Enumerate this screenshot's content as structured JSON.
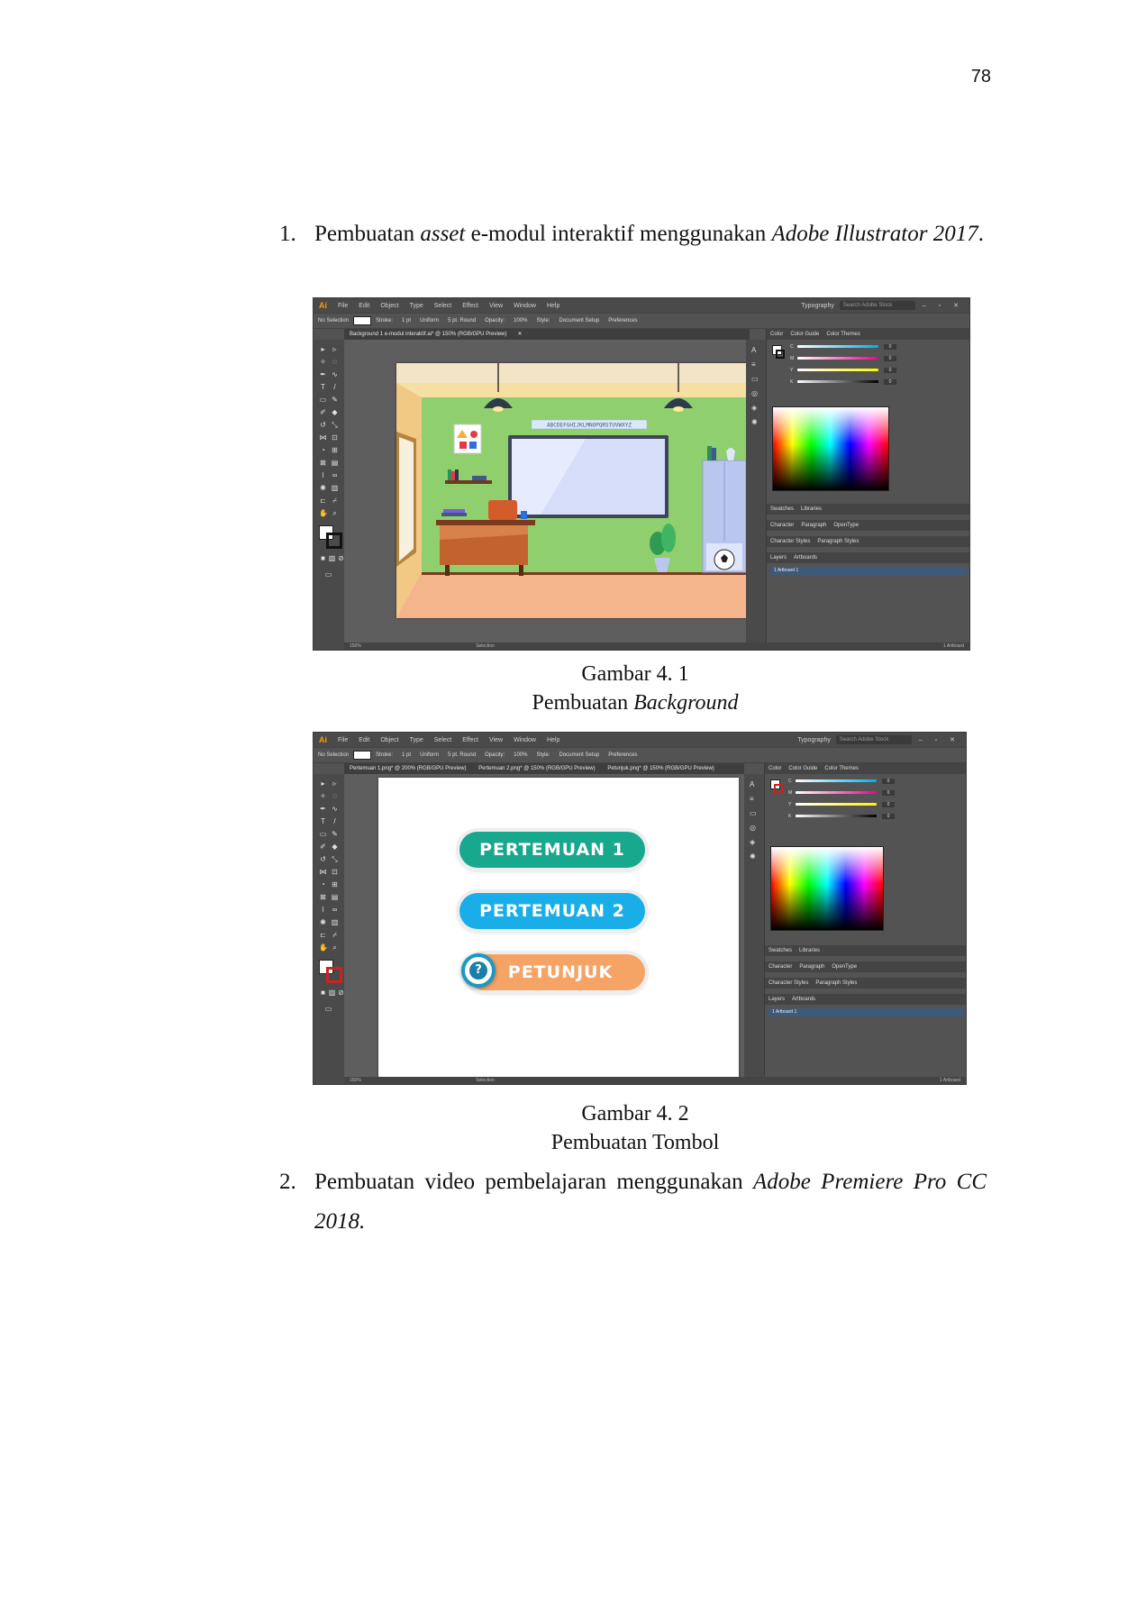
{
  "page_number": "78",
  "list_items": [
    {
      "number": "1.",
      "text_before": "Pembuatan ",
      "text_italic_1": "asset",
      "text_middle": " e-modul interaktif menggunakan ",
      "text_italic_2": "Adobe Illustrator 2017",
      "text_after": "."
    },
    {
      "number": "2.",
      "text_before": "Pembuatan video pembelajaran menggunakan ",
      "text_italic": "Adobe Premiere Pro CC 2018."
    }
  ],
  "figures": [
    {
      "caption_line1": "Gambar 4. 1",
      "caption_line2_prefix": "Pembuatan ",
      "caption_line2_italic": "Background"
    },
    {
      "caption_line1": "Gambar 4. 2",
      "caption_line2": "Pembuatan Tombol"
    }
  ],
  "illustrator_ui": {
    "logo": "Ai",
    "menu": [
      "File",
      "Edit",
      "Object",
      "Type",
      "Select",
      "Effect",
      "View",
      "Window",
      "Help"
    ],
    "workspace": "Typography",
    "search_placeholder": "Search Adobe Stock",
    "control_bar": [
      "No Selection",
      "Stroke:",
      "1 pt",
      "Uniform",
      "5 pt. Round",
      "Opacity:",
      "100%",
      "Style:",
      "Document Setup",
      "Preferences"
    ],
    "color_panel_tabs": [
      "Color",
      "Color Guide",
      "Color Themes"
    ],
    "color_sliders": [
      {
        "label": "C",
        "value": "0"
      },
      {
        "label": "M",
        "value": "0"
      },
      {
        "label": "Y",
        "value": "0"
      },
      {
        "label": "K",
        "value": "0"
      }
    ],
    "panel_rows": [
      [
        "Swatches",
        "Libraries"
      ],
      [
        "Character",
        "Paragraph",
        "OpenType"
      ],
      [
        "Character Styles",
        "Paragraph Styles"
      ],
      [
        "Layers",
        "Artboards"
      ]
    ],
    "artboard_row": "1     Artboard 1",
    "status_zoom": "150%",
    "status_tool": "Selection",
    "status_artboard": "1 Artboard"
  },
  "screenshot_1": {
    "document_tab": "Background 1 e-modul interaktif.ai* @ 150% (RGB/GPU Preview)",
    "alphabet_banner": "ABCDEFGHIJKLMNOPQRSTUVWXYZ",
    "colors": {
      "wall": "#8fcf6e",
      "floor": "#f4b48c",
      "side_wall": "#f6dfa3",
      "desk": "#c2632e",
      "cabinet": "#b9c7ef"
    }
  },
  "screenshot_2": {
    "document_tabs": [
      "Pertemuan 1.png* @ 200% (RGB/GPU Preview)",
      "Pertemuan 2.png* @ 150% (RGB/GPU Preview)",
      "Petunjuk.png* @ 150% (RGB/GPU Preview)"
    ],
    "buttons": [
      {
        "label": "PERTEMUAN 1",
        "color": "#17a88d"
      },
      {
        "label": "PERTEMUAN 2",
        "color": "#1aaee8"
      },
      {
        "label": "PETUNJUK",
        "color": "#f6a366"
      }
    ],
    "help_icon": "?"
  }
}
